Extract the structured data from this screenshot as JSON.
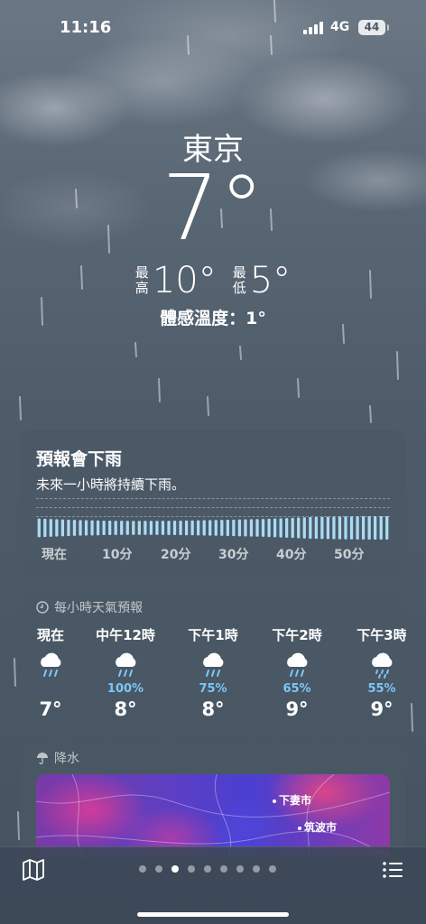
{
  "status_bar": {
    "time": "11:16",
    "network": "4G",
    "battery": "44"
  },
  "location": {
    "city": "東京",
    "temperature": "7°",
    "high_label": [
      "最",
      "高"
    ],
    "high": "10°",
    "low_label": [
      "最",
      "低"
    ],
    "low": "5°",
    "feels_like": "體感溫度：1°"
  },
  "precip_card": {
    "title": "預報會下雨",
    "subtitle": "未來一小時將持續下雨。",
    "axis_labels": [
      "現在",
      "10分",
      "20分",
      "30分",
      "40分",
      "50分"
    ],
    "intensity": [
      0.8,
      0.78,
      0.76,
      0.74,
      0.72,
      0.7,
      0.68,
      0.66,
      0.65,
      0.64,
      0.63,
      0.62,
      0.62,
      0.61,
      0.61,
      0.6,
      0.6,
      0.6,
      0.6,
      0.6,
      0.6,
      0.61,
      0.61,
      0.62,
      0.62,
      0.63,
      0.63,
      0.64,
      0.65,
      0.66,
      0.67,
      0.68,
      0.69,
      0.7,
      0.72,
      0.73,
      0.74,
      0.75,
      0.76,
      0.78,
      0.8,
      0.82,
      0.84,
      0.86,
      0.88,
      0.9,
      0.92,
      0.93,
      0.94,
      0.95,
      0.96,
      0.97,
      0.98,
      0.98,
      0.99,
      1.0,
      1.0,
      1.0,
      1.0,
      1.0
    ]
  },
  "hourly_card": {
    "header": "每小時天氣預報",
    "hours": [
      {
        "label": "現在",
        "icon": "rain-icon",
        "prob": "",
        "temp": "7°"
      },
      {
        "label": "中午12時",
        "icon": "rain-icon",
        "prob": "100%",
        "temp": "8°"
      },
      {
        "label": "下午1時",
        "icon": "rain-icon",
        "prob": "75%",
        "temp": "8°"
      },
      {
        "label": "下午2時",
        "icon": "rain-icon",
        "prob": "65%",
        "temp": "9°"
      },
      {
        "label": "下午3時",
        "icon": "drizzle-icon",
        "prob": "55%",
        "temp": "9°"
      }
    ]
  },
  "precip_map_card": {
    "header": "降水",
    "places": [
      "下妻市",
      "筑波市"
    ]
  },
  "page_indicator": {
    "count": 9,
    "active": 2
  },
  "colors": {
    "accent_probability": "#7cc7f5",
    "precip_bar": "#a9dbf5"
  }
}
